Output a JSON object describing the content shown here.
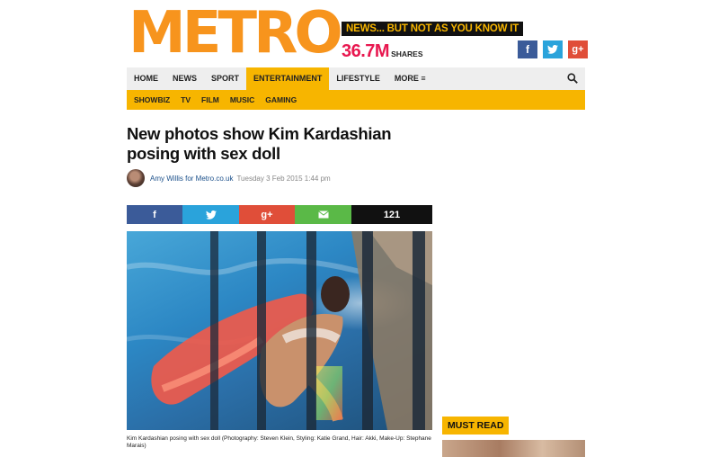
{
  "brand": {
    "logo_text": "METRO",
    "tagline": "NEWS... BUT NOT AS YOU KNOW IT",
    "shares_count": "36.7M",
    "shares_label": "SHARES",
    "logo_color": "#f7941d",
    "accent_color": "#f7b500"
  },
  "social_top": [
    {
      "icon": "facebook-icon",
      "glyph": "f",
      "color": "#3b5b99"
    },
    {
      "icon": "twitter-icon",
      "glyph": "🐦",
      "color": "#2aa3db"
    },
    {
      "icon": "google-plus-icon",
      "glyph": "g+",
      "color": "#e04e39"
    }
  ],
  "nav": {
    "items": [
      "HOME",
      "NEWS",
      "SPORT",
      "ENTERTAINMENT",
      "LIFESTYLE",
      "MORE ≡"
    ],
    "active": "ENTERTAINMENT"
  },
  "subnav": {
    "items": [
      "SHOWBIZ",
      "TV",
      "FILM",
      "MUSIC",
      "GAMING"
    ]
  },
  "article": {
    "headline": "New photos show Kim Kardashian posing with sex doll",
    "author": "Amy Willis for Metro.co.uk",
    "date": "Tuesday 3 Feb 2015 1:44 pm",
    "share_count": "121",
    "caption": "Kim Kardashian posing with sex doll (Photography: Steven Klein, Styling: Katie Grand, Hair: Akki, Make-Up: Stephane Marais)"
  },
  "sidebar": {
    "must_read_label": "MUST READ"
  }
}
